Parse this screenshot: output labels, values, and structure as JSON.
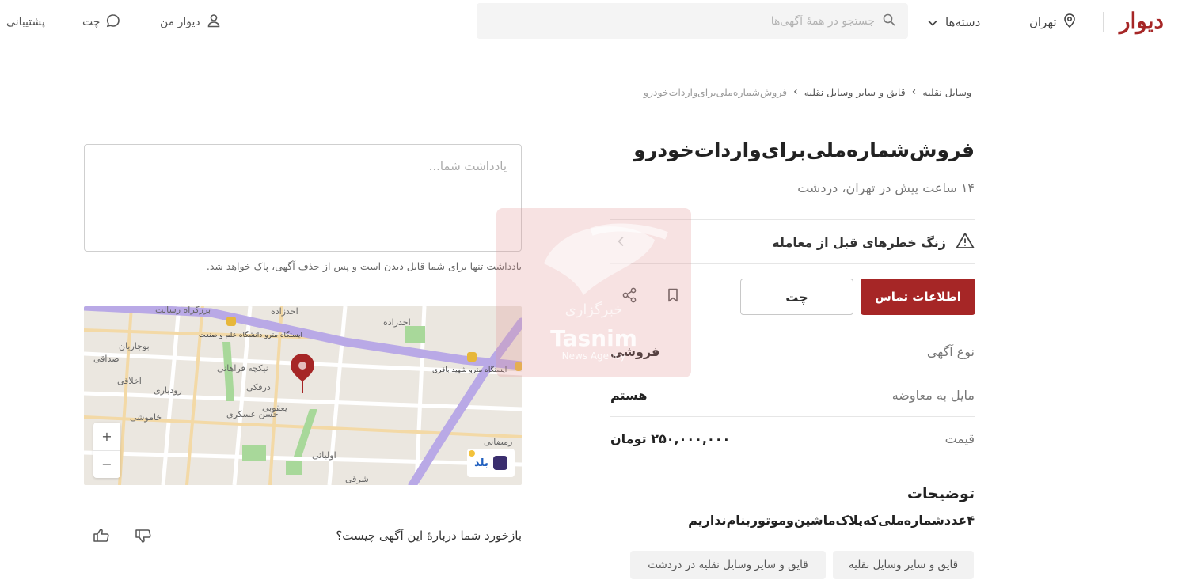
{
  "header": {
    "logo": "دیوار",
    "city": "تهران",
    "categories_label": "دسته‌ها",
    "search_placeholder": "جستجو در همهٔ آگهی‌ها",
    "my_divar": "دیوار من",
    "chat": "چت",
    "support": "پشتیبانی"
  },
  "breadcrumb": {
    "items": [
      "وسایل نقلیه",
      "قایق و سایر وسایل نقلیه",
      "فروش‌شماره‌ملی‌برای‌واردات‌خودرو"
    ]
  },
  "ad": {
    "title": "فروش‌شماره‌ملی‌برای‌واردات‌خودرو",
    "subtitle": "۱۴ ساعت پیش در تهران، دردشت",
    "warning": "زنگ خطرهای قبل از معامله",
    "contact_button": "اطلاعات تماس",
    "chat_button": "چت",
    "rows": [
      {
        "key": "نوع آگهی",
        "value": "فروشی"
      },
      {
        "key": "مایل به معاوضه",
        "value": "هستم"
      },
      {
        "key": "قیمت",
        "value": "۲۵۰,۰۰۰,۰۰۰ تومان"
      }
    ],
    "description_title": "توضیحات",
    "description": "۴عددشماره‌ملی‌که‌پلاک‌ماشین‌وموتوربنام‌نداریم",
    "tags": [
      "قایق و سایر وسایل نقلیه",
      "قایق و سایر وسایل نقلیه در دردشت"
    ]
  },
  "note": {
    "placeholder": "یادداشت شما...",
    "hint": "یادداشت تنها برای شما قابل دیدن است و پس از حذف آگهی، پاک خواهد شد."
  },
  "map": {
    "labels": [
      "بزرگراه رسالت",
      "احدزاده",
      "احدزاده",
      "ایستگاه مترو دانشگاه علم و صنعت",
      "ایستگاه مترو شهید باقری",
      "بوجاریان",
      "نیکچه فراهانی",
      "درفکی",
      "یعقوبی",
      "اخلاقی",
      "رودباری",
      "خاموشی",
      "صداقی",
      "اولیائی",
      "رمضانی",
      "حسن عسکری",
      "شرقی"
    ],
    "zoom_in": "+",
    "zoom_out": "−",
    "provider": "بلد"
  },
  "feedback": {
    "question": "بازخورد شما دربارهٔ این آگهی چیست؟"
  },
  "watermark": {
    "name_en": "Tasnim",
    "agency_en": "News Agency",
    "agency_fa": "خبرگزاری"
  },
  "colors": {
    "brand": "#a62626",
    "map_road_purple": "#b9a9e6",
    "map_bg": "#ebe7e0"
  }
}
